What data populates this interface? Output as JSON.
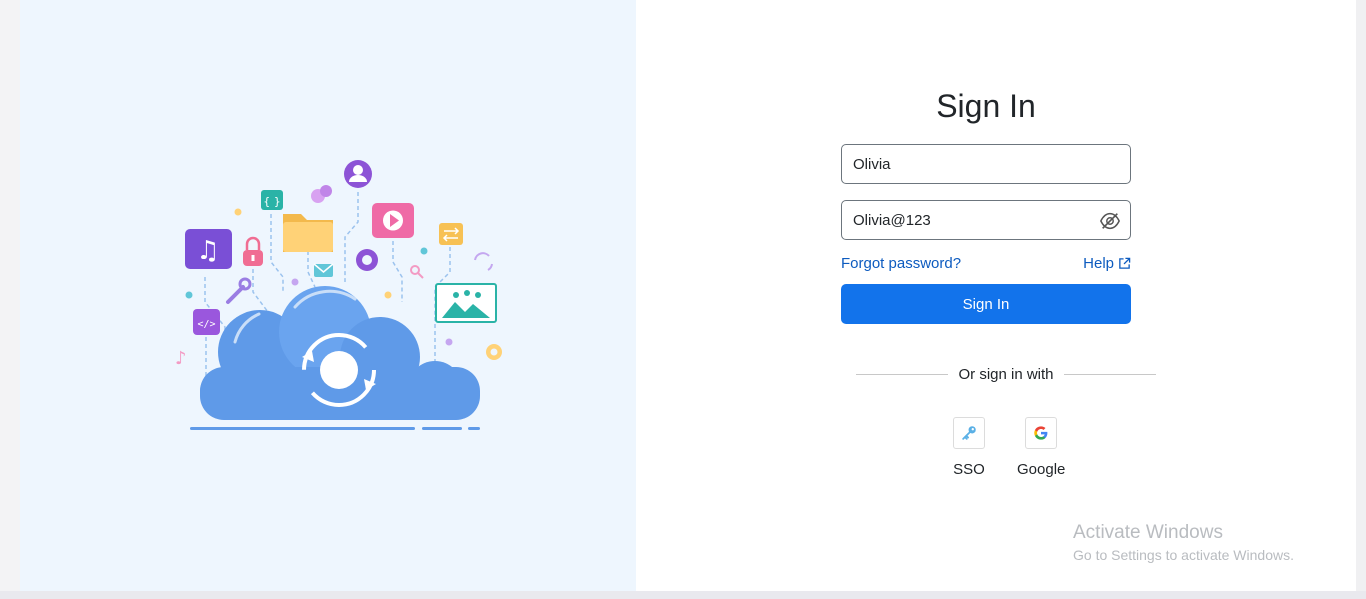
{
  "left_panel": {
    "illustration": "cloud-sync-illustration"
  },
  "signin": {
    "title": "Sign In",
    "username_value": "Olivia",
    "password_value": "Olivia@123",
    "forgot_label": "Forgot password?",
    "help_label": "Help",
    "button_label": "Sign In",
    "divider_label": "Or sign in with",
    "providers": [
      {
        "label": "SSO",
        "icon": "key-icon"
      },
      {
        "label": "Google",
        "icon": "google-g-icon"
      }
    ]
  },
  "watermark": {
    "line1": "Activate Windows",
    "line2": "Go to Settings to activate Windows."
  },
  "colors": {
    "primary": "#1273eb",
    "link": "#0d5bbf",
    "left_bg": "#eef6fe",
    "cloud": "#5f9ae8"
  }
}
